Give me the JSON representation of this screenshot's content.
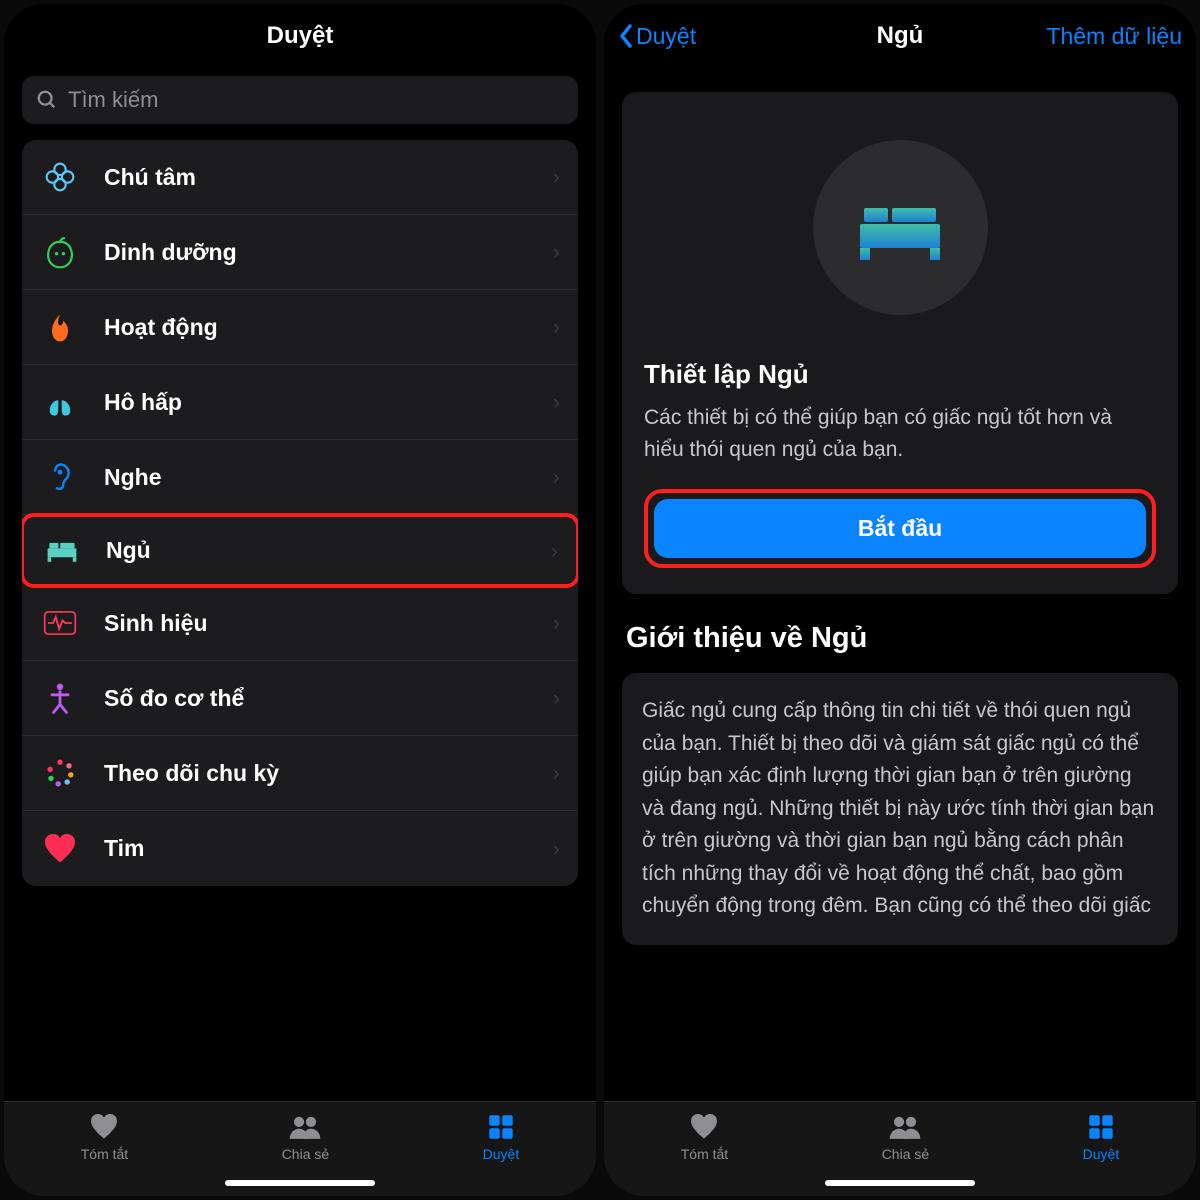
{
  "left": {
    "title": "Duyệt",
    "search_placeholder": "Tìm kiếm",
    "items": [
      {
        "label": "Chú tâm"
      },
      {
        "label": "Dinh dưỡng"
      },
      {
        "label": "Hoạt động"
      },
      {
        "label": "Hô hấp"
      },
      {
        "label": "Nghe"
      },
      {
        "label": "Ngủ"
      },
      {
        "label": "Sinh hiệu"
      },
      {
        "label": "Số đo cơ thể"
      },
      {
        "label": "Theo dõi chu kỳ"
      },
      {
        "label": "Tim"
      }
    ]
  },
  "right": {
    "back_label": "Duyệt",
    "title": "Ngủ",
    "action_label": "Thêm dữ liệu",
    "setup_title": "Thiết lập Ngủ",
    "setup_desc": "Các thiết bị có thể giúp bạn có giấc ngủ tốt hơn và hiểu thói quen ngủ của bạn.",
    "cta_label": "Bắt đầu",
    "about_title": "Giới thiệu về Ngủ",
    "about_body": "Giấc ngủ cung cấp thông tin chi tiết về thói quen ngủ của bạn. Thiết bị theo dõi và giám sát giấc ngủ có thể giúp bạn xác định lượng thời gian bạn ở trên giường và đang ngủ. Những thiết bị này ước tính thời gian bạn ở trên giường và thời gian bạn ngủ bằng cách phân tích những thay đổi về hoạt động thể chất, bao gồm chuyển động trong đêm. Bạn cũng có thể theo dõi giấc"
  },
  "tabs": [
    {
      "label": "Tóm tắt"
    },
    {
      "label": "Chia sẻ"
    },
    {
      "label": "Duyệt"
    }
  ]
}
